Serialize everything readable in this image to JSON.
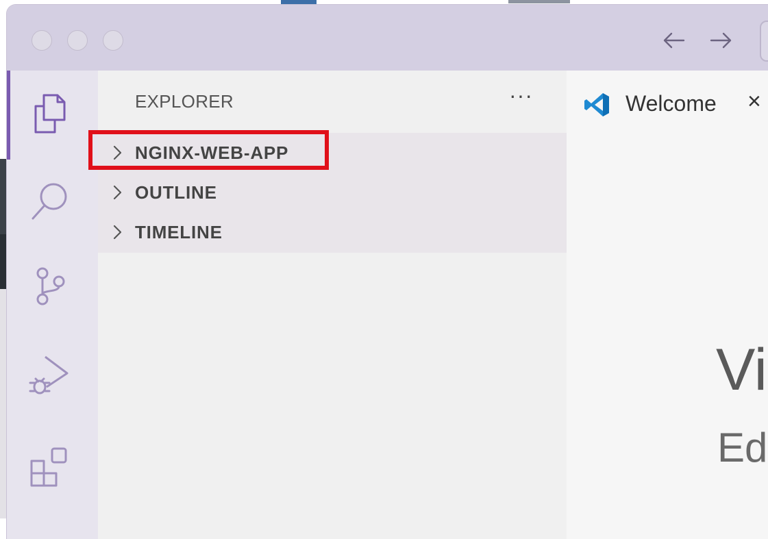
{
  "window": {
    "nav_back_icon": "arrow-left-icon",
    "nav_forward_icon": "arrow-right-icon"
  },
  "activity_bar": {
    "items": [
      {
        "name": "explorer",
        "icon": "files-icon",
        "active": true
      },
      {
        "name": "search",
        "icon": "search-icon",
        "active": false
      },
      {
        "name": "source-control",
        "icon": "source-control-icon",
        "active": false
      },
      {
        "name": "run-and-debug",
        "icon": "run-debug-icon",
        "active": false
      },
      {
        "name": "extensions",
        "icon": "extensions-icon",
        "active": false
      }
    ],
    "accent_color": "#7a5bb0"
  },
  "sidebar": {
    "title": "EXPLORER",
    "more_label": "···",
    "sections": [
      {
        "label": "NGINX-WEB-APP",
        "expanded": false,
        "highlighted": true
      },
      {
        "label": "OUTLINE",
        "expanded": false,
        "highlighted": false
      },
      {
        "label": "TIMELINE",
        "expanded": false,
        "highlighted": false
      }
    ],
    "highlight_color": "#e0101a"
  },
  "editor": {
    "tab": {
      "label": "Welcome",
      "close_label": "×",
      "icon": "vscode-logo-icon"
    },
    "welcome_title": "Vi",
    "welcome_subtitle": "Ed"
  }
}
